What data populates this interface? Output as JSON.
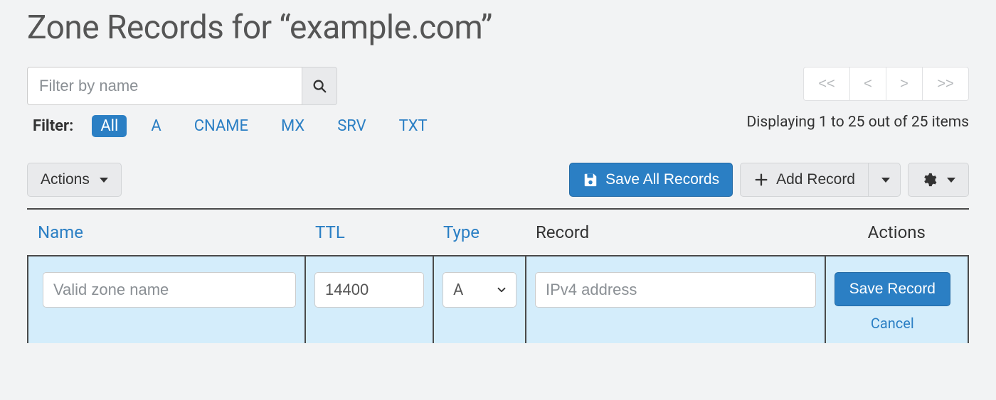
{
  "page": {
    "title": "Zone Records for “example.com”"
  },
  "filter": {
    "search_placeholder": "Filter by name",
    "label": "Filter:",
    "tabs": [
      {
        "label": "All",
        "active": true
      },
      {
        "label": "A",
        "active": false
      },
      {
        "label": "CNAME",
        "active": false
      },
      {
        "label": "MX",
        "active": false
      },
      {
        "label": "SRV",
        "active": false
      },
      {
        "label": "TXT",
        "active": false
      }
    ]
  },
  "pager": {
    "first": "<<",
    "prev": "<",
    "next": ">",
    "last": ">>",
    "status": "Displaying 1 to 25 out of 25 items"
  },
  "toolbar": {
    "actions_label": "Actions",
    "save_all_label": "Save All Records",
    "add_record_label": "Add Record"
  },
  "table": {
    "columns": {
      "name": "Name",
      "ttl": "TTL",
      "type": "Type",
      "record": "Record",
      "actions": "Actions"
    }
  },
  "edit_row": {
    "name_placeholder": "Valid zone name",
    "ttl_value": "14400",
    "type_selected": "A",
    "record_placeholder": "IPv4 address",
    "save_label": "Save Record",
    "cancel_label": "Cancel"
  },
  "colors": {
    "primary": "#2b7fc4",
    "row_highlight": "#d4edfb"
  }
}
